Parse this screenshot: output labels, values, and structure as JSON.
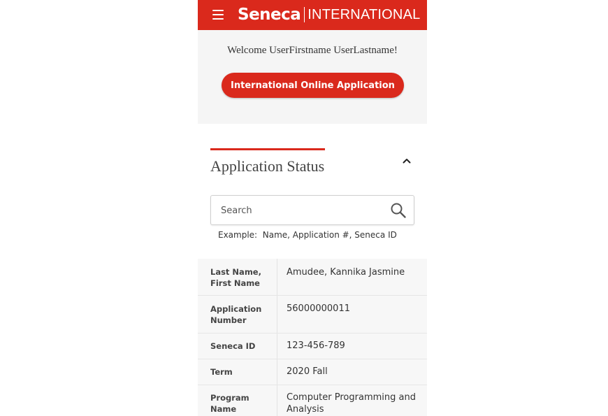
{
  "header": {
    "logo_main": "Seneca",
    "logo_sub": "INTERNATIONAL",
    "menu_icon": "hamburger-menu-icon",
    "brand_color": "#da291c"
  },
  "welcome": {
    "text": "Welcome UserFirstname UserLastname!",
    "button_label": "International Online Application"
  },
  "status": {
    "title": "Application Status",
    "toggle_icon": "chevron-up-icon",
    "search_placeholder": "Search",
    "search_icon": "search-icon",
    "example": "Example:  Name, Application #, Seneca ID"
  },
  "rows": [
    {
      "label": "Last Name, First Name",
      "value": "Amudee, Kannika Jasmine"
    },
    {
      "label": "Application Number",
      "value": "56000000011"
    },
    {
      "label": "Seneca ID",
      "value": "123-456-789"
    },
    {
      "label": "Term",
      "value": "2020 Fall"
    },
    {
      "label": "Program Name",
      "value": "Computer Programming and Analysis"
    }
  ]
}
